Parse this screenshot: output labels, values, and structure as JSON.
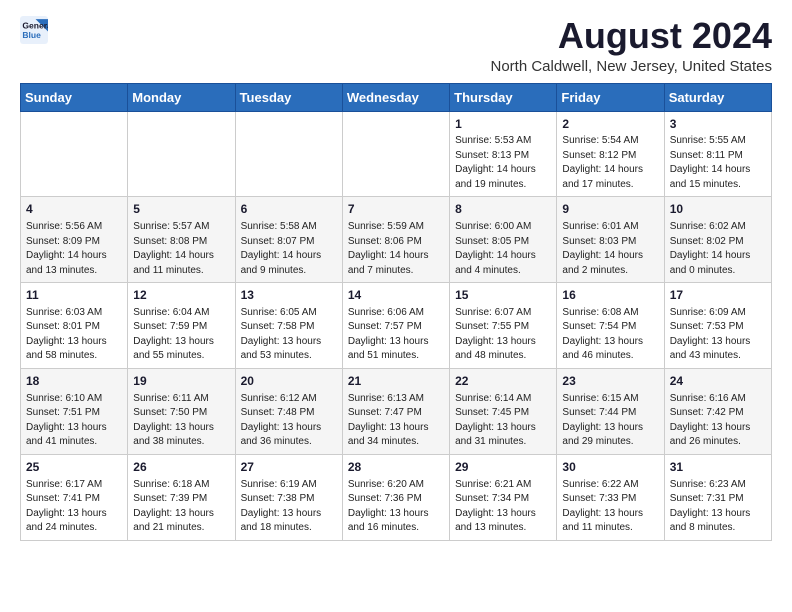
{
  "header": {
    "logo_line1": "General",
    "logo_line2": "Blue",
    "title": "August 2024",
    "subtitle": "North Caldwell, New Jersey, United States"
  },
  "weekdays": [
    "Sunday",
    "Monday",
    "Tuesday",
    "Wednesday",
    "Thursday",
    "Friday",
    "Saturday"
  ],
  "weeks": [
    [
      {
        "day": "",
        "text": ""
      },
      {
        "day": "",
        "text": ""
      },
      {
        "day": "",
        "text": ""
      },
      {
        "day": "",
        "text": ""
      },
      {
        "day": "1",
        "text": "Sunrise: 5:53 AM\nSunset: 8:13 PM\nDaylight: 14 hours\nand 19 minutes."
      },
      {
        "day": "2",
        "text": "Sunrise: 5:54 AM\nSunset: 8:12 PM\nDaylight: 14 hours\nand 17 minutes."
      },
      {
        "day": "3",
        "text": "Sunrise: 5:55 AM\nSunset: 8:11 PM\nDaylight: 14 hours\nand 15 minutes."
      }
    ],
    [
      {
        "day": "4",
        "text": "Sunrise: 5:56 AM\nSunset: 8:09 PM\nDaylight: 14 hours\nand 13 minutes."
      },
      {
        "day": "5",
        "text": "Sunrise: 5:57 AM\nSunset: 8:08 PM\nDaylight: 14 hours\nand 11 minutes."
      },
      {
        "day": "6",
        "text": "Sunrise: 5:58 AM\nSunset: 8:07 PM\nDaylight: 14 hours\nand 9 minutes."
      },
      {
        "day": "7",
        "text": "Sunrise: 5:59 AM\nSunset: 8:06 PM\nDaylight: 14 hours\nand 7 minutes."
      },
      {
        "day": "8",
        "text": "Sunrise: 6:00 AM\nSunset: 8:05 PM\nDaylight: 14 hours\nand 4 minutes."
      },
      {
        "day": "9",
        "text": "Sunrise: 6:01 AM\nSunset: 8:03 PM\nDaylight: 14 hours\nand 2 minutes."
      },
      {
        "day": "10",
        "text": "Sunrise: 6:02 AM\nSunset: 8:02 PM\nDaylight: 14 hours\nand 0 minutes."
      }
    ],
    [
      {
        "day": "11",
        "text": "Sunrise: 6:03 AM\nSunset: 8:01 PM\nDaylight: 13 hours\nand 58 minutes."
      },
      {
        "day": "12",
        "text": "Sunrise: 6:04 AM\nSunset: 7:59 PM\nDaylight: 13 hours\nand 55 minutes."
      },
      {
        "day": "13",
        "text": "Sunrise: 6:05 AM\nSunset: 7:58 PM\nDaylight: 13 hours\nand 53 minutes."
      },
      {
        "day": "14",
        "text": "Sunrise: 6:06 AM\nSunset: 7:57 PM\nDaylight: 13 hours\nand 51 minutes."
      },
      {
        "day": "15",
        "text": "Sunrise: 6:07 AM\nSunset: 7:55 PM\nDaylight: 13 hours\nand 48 minutes."
      },
      {
        "day": "16",
        "text": "Sunrise: 6:08 AM\nSunset: 7:54 PM\nDaylight: 13 hours\nand 46 minutes."
      },
      {
        "day": "17",
        "text": "Sunrise: 6:09 AM\nSunset: 7:53 PM\nDaylight: 13 hours\nand 43 minutes."
      }
    ],
    [
      {
        "day": "18",
        "text": "Sunrise: 6:10 AM\nSunset: 7:51 PM\nDaylight: 13 hours\nand 41 minutes."
      },
      {
        "day": "19",
        "text": "Sunrise: 6:11 AM\nSunset: 7:50 PM\nDaylight: 13 hours\nand 38 minutes."
      },
      {
        "day": "20",
        "text": "Sunrise: 6:12 AM\nSunset: 7:48 PM\nDaylight: 13 hours\nand 36 minutes."
      },
      {
        "day": "21",
        "text": "Sunrise: 6:13 AM\nSunset: 7:47 PM\nDaylight: 13 hours\nand 34 minutes."
      },
      {
        "day": "22",
        "text": "Sunrise: 6:14 AM\nSunset: 7:45 PM\nDaylight: 13 hours\nand 31 minutes."
      },
      {
        "day": "23",
        "text": "Sunrise: 6:15 AM\nSunset: 7:44 PM\nDaylight: 13 hours\nand 29 minutes."
      },
      {
        "day": "24",
        "text": "Sunrise: 6:16 AM\nSunset: 7:42 PM\nDaylight: 13 hours\nand 26 minutes."
      }
    ],
    [
      {
        "day": "25",
        "text": "Sunrise: 6:17 AM\nSunset: 7:41 PM\nDaylight: 13 hours\nand 24 minutes."
      },
      {
        "day": "26",
        "text": "Sunrise: 6:18 AM\nSunset: 7:39 PM\nDaylight: 13 hours\nand 21 minutes."
      },
      {
        "day": "27",
        "text": "Sunrise: 6:19 AM\nSunset: 7:38 PM\nDaylight: 13 hours\nand 18 minutes."
      },
      {
        "day": "28",
        "text": "Sunrise: 6:20 AM\nSunset: 7:36 PM\nDaylight: 13 hours\nand 16 minutes."
      },
      {
        "day": "29",
        "text": "Sunrise: 6:21 AM\nSunset: 7:34 PM\nDaylight: 13 hours\nand 13 minutes."
      },
      {
        "day": "30",
        "text": "Sunrise: 6:22 AM\nSunset: 7:33 PM\nDaylight: 13 hours\nand 11 minutes."
      },
      {
        "day": "31",
        "text": "Sunrise: 6:23 AM\nSunset: 7:31 PM\nDaylight: 13 hours\nand 8 minutes."
      }
    ]
  ]
}
